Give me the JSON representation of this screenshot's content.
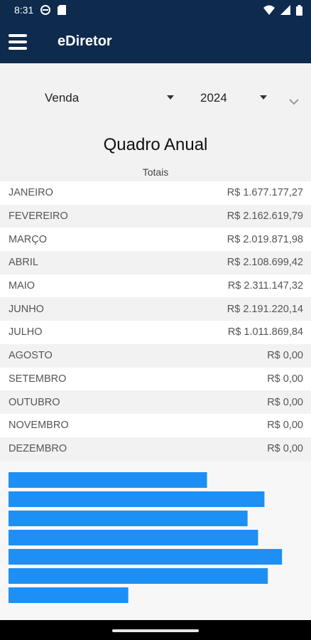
{
  "status": {
    "time": "8:31"
  },
  "app": {
    "title": "eDiretor"
  },
  "filters": {
    "type_selected": "Venda",
    "year_selected": "2024"
  },
  "section": {
    "title": "Quadro Anual",
    "subtitle": "Totais"
  },
  "months": [
    {
      "name": "JANEIRO",
      "total": "R$ 1.677.177,27",
      "value": 1677177.27
    },
    {
      "name": "FEVEREIRO",
      "total": "R$ 2.162.619,79",
      "value": 2162619.79
    },
    {
      "name": "MARÇO",
      "total": "R$ 2.019.871,98",
      "value": 2019871.98
    },
    {
      "name": "ABRIL",
      "total": "R$ 2.108.699,42",
      "value": 2108699.42
    },
    {
      "name": "MAIO",
      "total": "R$ 2.311.147,32",
      "value": 2311147.32
    },
    {
      "name": "JUNHO",
      "total": "R$ 2.191.220,14",
      "value": 2191220.14
    },
    {
      "name": "JULHO",
      "total": "R$ 1.011.869,84",
      "value": 1011869.84
    },
    {
      "name": "AGOSTO",
      "total": "R$ 0,00",
      "value": 0
    },
    {
      "name": "SETEMBRO",
      "total": "R$ 0,00",
      "value": 0
    },
    {
      "name": "OUTUBRO",
      "total": "R$ 0,00",
      "value": 0
    },
    {
      "name": "NOVEMBRO",
      "total": "R$ 0,00",
      "value": 0
    },
    {
      "name": "DEZEMBRO",
      "total": "R$ 0,00",
      "value": 0
    }
  ],
  "chart_data": {
    "type": "bar",
    "orientation": "horizontal",
    "categories": [
      "JANEIRO",
      "FEVEREIRO",
      "MARÇO",
      "ABRIL",
      "MAIO",
      "JUNHO",
      "JULHO"
    ],
    "values": [
      1677177.27,
      2162619.79,
      2019871.98,
      2108699.42,
      2311147.32,
      2191220.14,
      1011869.84
    ],
    "color": "#1e8ff5"
  },
  "colors": {
    "appbar": "#0e2a4d",
    "bar": "#1e8ff5"
  }
}
